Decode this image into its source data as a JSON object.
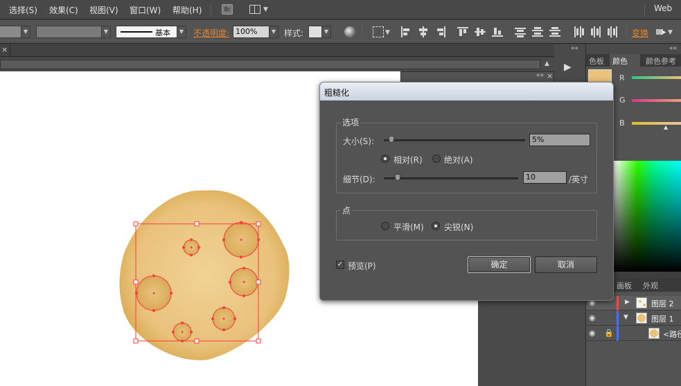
{
  "menu": {
    "items": [
      "选择(S)",
      "效果(C)",
      "视图(V)",
      "窗口(W)",
      "帮助(H)"
    ],
    "bridge_badge": "Br",
    "workspace": "Web"
  },
  "control_bar": {
    "stroke_profile": "基本",
    "opacity_label": "不透明度:",
    "opacity_value": "100%",
    "style_label": "样式:",
    "transform_label": "变换"
  },
  "right_panel": {
    "tabs": [
      "色板",
      "颜色",
      "颜色参考"
    ],
    "channels": [
      "R",
      "G",
      "B"
    ],
    "lower_tabs": [
      "画板",
      "外观"
    ],
    "layers": [
      {
        "name": "图层 2"
      },
      {
        "name": "图层 1"
      },
      {
        "name": "<路径>"
      }
    ]
  },
  "dialog": {
    "title": "粗糙化",
    "options_group": "选项",
    "size_label": "大小(S):",
    "size_value": "5%",
    "size_fraction": 0.05,
    "relative_label": "相对(R)",
    "absolute_label": "绝对(A)",
    "detail_label": "细节(D):",
    "detail_value": "10",
    "detail_unit": "/英寸",
    "detail_fraction": 0.1,
    "points_group": "点",
    "smooth_label": "平滑(M)",
    "corner_label": "尖锐(N)",
    "preview_label": "预览(P)",
    "preview_checked": true,
    "ok_label": "确定",
    "cancel_label": "取消"
  },
  "colors": {
    "accent_orange": "#e8842a",
    "cookie": "#e9c27c",
    "selection": "#ff3b3b"
  }
}
